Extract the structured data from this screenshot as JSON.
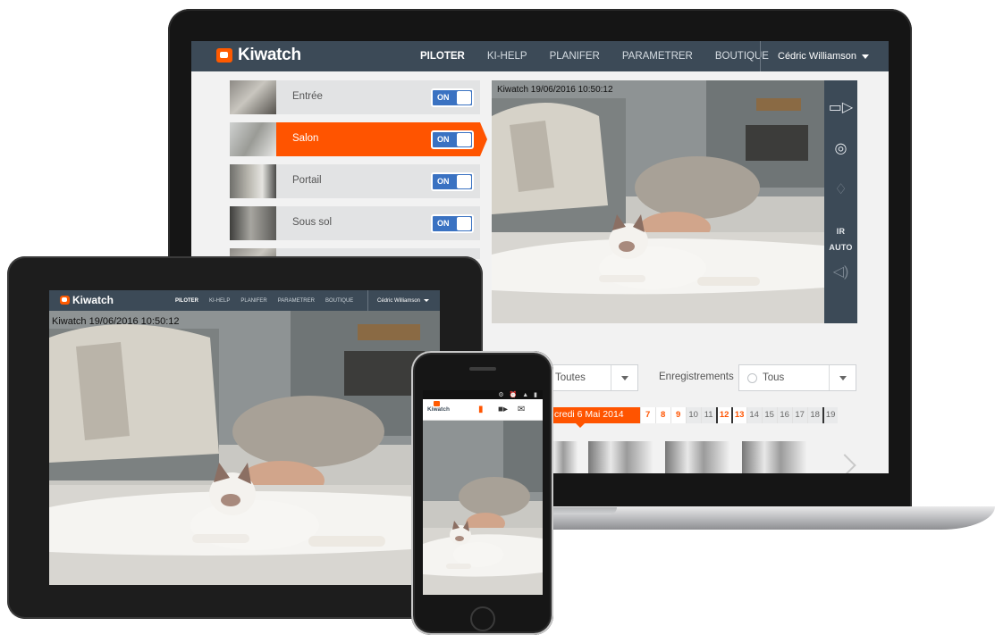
{
  "brand": {
    "name": "Kiwatch",
    "accent": "#ff5400",
    "topbar": "#3c4a57",
    "toggle": "#3a72c2"
  },
  "laptop": {
    "nav": {
      "items": [
        "PILOTER",
        "KI-HELP",
        "PLANIFER",
        "PARAMETRER",
        "BOUTIQUE"
      ],
      "active": "PILOTER"
    },
    "user": "Cédric Williamson",
    "cameras": [
      {
        "name": "Entrée",
        "toggle": "ON",
        "active": false
      },
      {
        "name": "Salon",
        "toggle": "ON",
        "active": true
      },
      {
        "name": "Portail",
        "toggle": "ON",
        "active": false
      },
      {
        "name": "Sous sol",
        "toggle": "ON",
        "active": false
      }
    ],
    "timestamp": "Kiwatch 19/06/2016 10:50:12",
    "tools": {
      "video": "video-camera-icon",
      "photo": "camera-icon",
      "light": "light-bulb-icon",
      "ir": "IR AUTO",
      "sound": "speaker-icon"
    },
    "filters": {
      "cameras_value": "Toutes",
      "recordings_label": "Enregistrements",
      "recordings_value": "Tous"
    },
    "calendar": {
      "current": "Mercredi 6 Mai 2014",
      "current_visible": "credi 6 Mai 2014",
      "days": [
        {
          "n": "7",
          "state": "on"
        },
        {
          "n": "8",
          "state": "on"
        },
        {
          "n": "9",
          "state": "on"
        },
        {
          "n": "10",
          "state": "off"
        },
        {
          "n": "11",
          "state": "off"
        },
        {
          "n": "12",
          "state": "on"
        },
        {
          "n": "13",
          "state": "on"
        },
        {
          "n": "14",
          "state": "off"
        },
        {
          "n": "15",
          "state": "off"
        },
        {
          "n": "16",
          "state": "off"
        },
        {
          "n": "17",
          "state": "off"
        },
        {
          "n": "18",
          "state": "off"
        },
        {
          "n": "19",
          "state": "off"
        }
      ]
    }
  },
  "tablet": {
    "nav": {
      "items": [
        "PILOTER",
        "KI-HELP",
        "PLANIFER",
        "PARAMETRER",
        "BOUTIQUE"
      ],
      "active": "PILOTER"
    },
    "user": "Cédric Williamson",
    "timestamp": "Kiwatch 19/06/2016 10:50:12"
  },
  "phone": {
    "logo": "Kiwatch",
    "status_icons": "⚙ ⏰ ▲ ▮"
  }
}
